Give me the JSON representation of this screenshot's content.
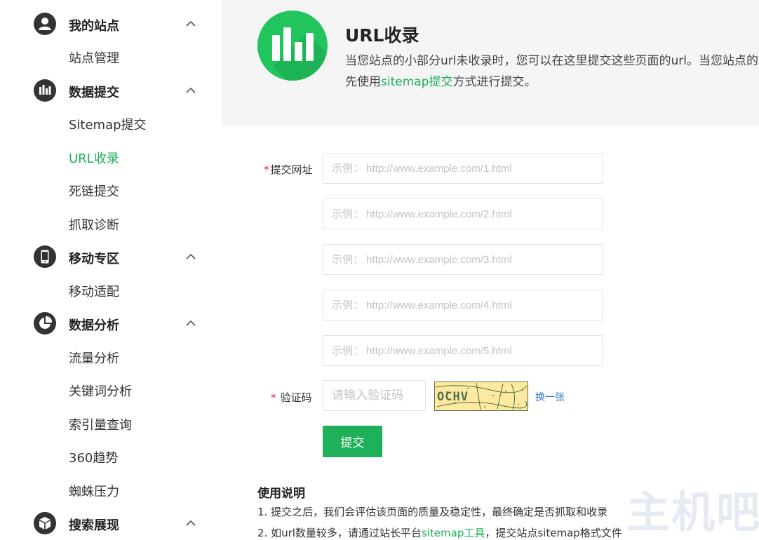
{
  "sidebar": {
    "groups": [
      {
        "title": "我的站点",
        "items": [
          "站点管理"
        ]
      },
      {
        "title": "数据提交",
        "items": [
          "Sitemap提交",
          "URL收录",
          "死链提交",
          "抓取诊断"
        ]
      },
      {
        "title": "移动专区",
        "items": [
          "移动适配"
        ]
      },
      {
        "title": "数据分析",
        "items": [
          "流量分析",
          "关键词分析",
          "索引量查询",
          "360趋势",
          "蜘蛛压力"
        ]
      },
      {
        "title": "搜索展现",
        "items": []
      }
    ],
    "active_item": "URL收录"
  },
  "header": {
    "title": "URL收录",
    "desc_line1": "当您站点的小部分url未收录时，您可以在这里提交这些页面的url。当您站点的",
    "desc_line2_prefix": "先使用",
    "desc_line2_link": "sitemap提交",
    "desc_line2_suffix": "方式进行提交。"
  },
  "form": {
    "url_label_required": "*",
    "url_label": "提交网址",
    "url_placeholders": [
      "示例： http://www.example.com/1.html",
      "示例： http://www.example.com/2.html",
      "示例： http://www.example.com/3.html",
      "示例： http://www.example.com/4.html",
      "示例： http://www.example.com/5.html"
    ],
    "captcha_label_required": "*",
    "captcha_label": "验证码",
    "captcha_placeholder": "请输入验证码",
    "captcha_text": "OCHV",
    "refresh_link": "换一张",
    "submit_label": "提交"
  },
  "usage": {
    "title": "使用说明",
    "item1": "1. 提交之后，我们会评估该页面的质量及稳定性，最终确定是否抓取和收录",
    "item2_prefix": "2. 如url数量较多，请通过站长平台",
    "item2_link": "sitemap工具",
    "item2_suffix": "，提交站点sitemap格式文件"
  },
  "watermark": "主机吧",
  "colors": {
    "accent": "#1fb05b",
    "link_blue": "#2b76c4",
    "header_bg": "#f5f5f5"
  }
}
